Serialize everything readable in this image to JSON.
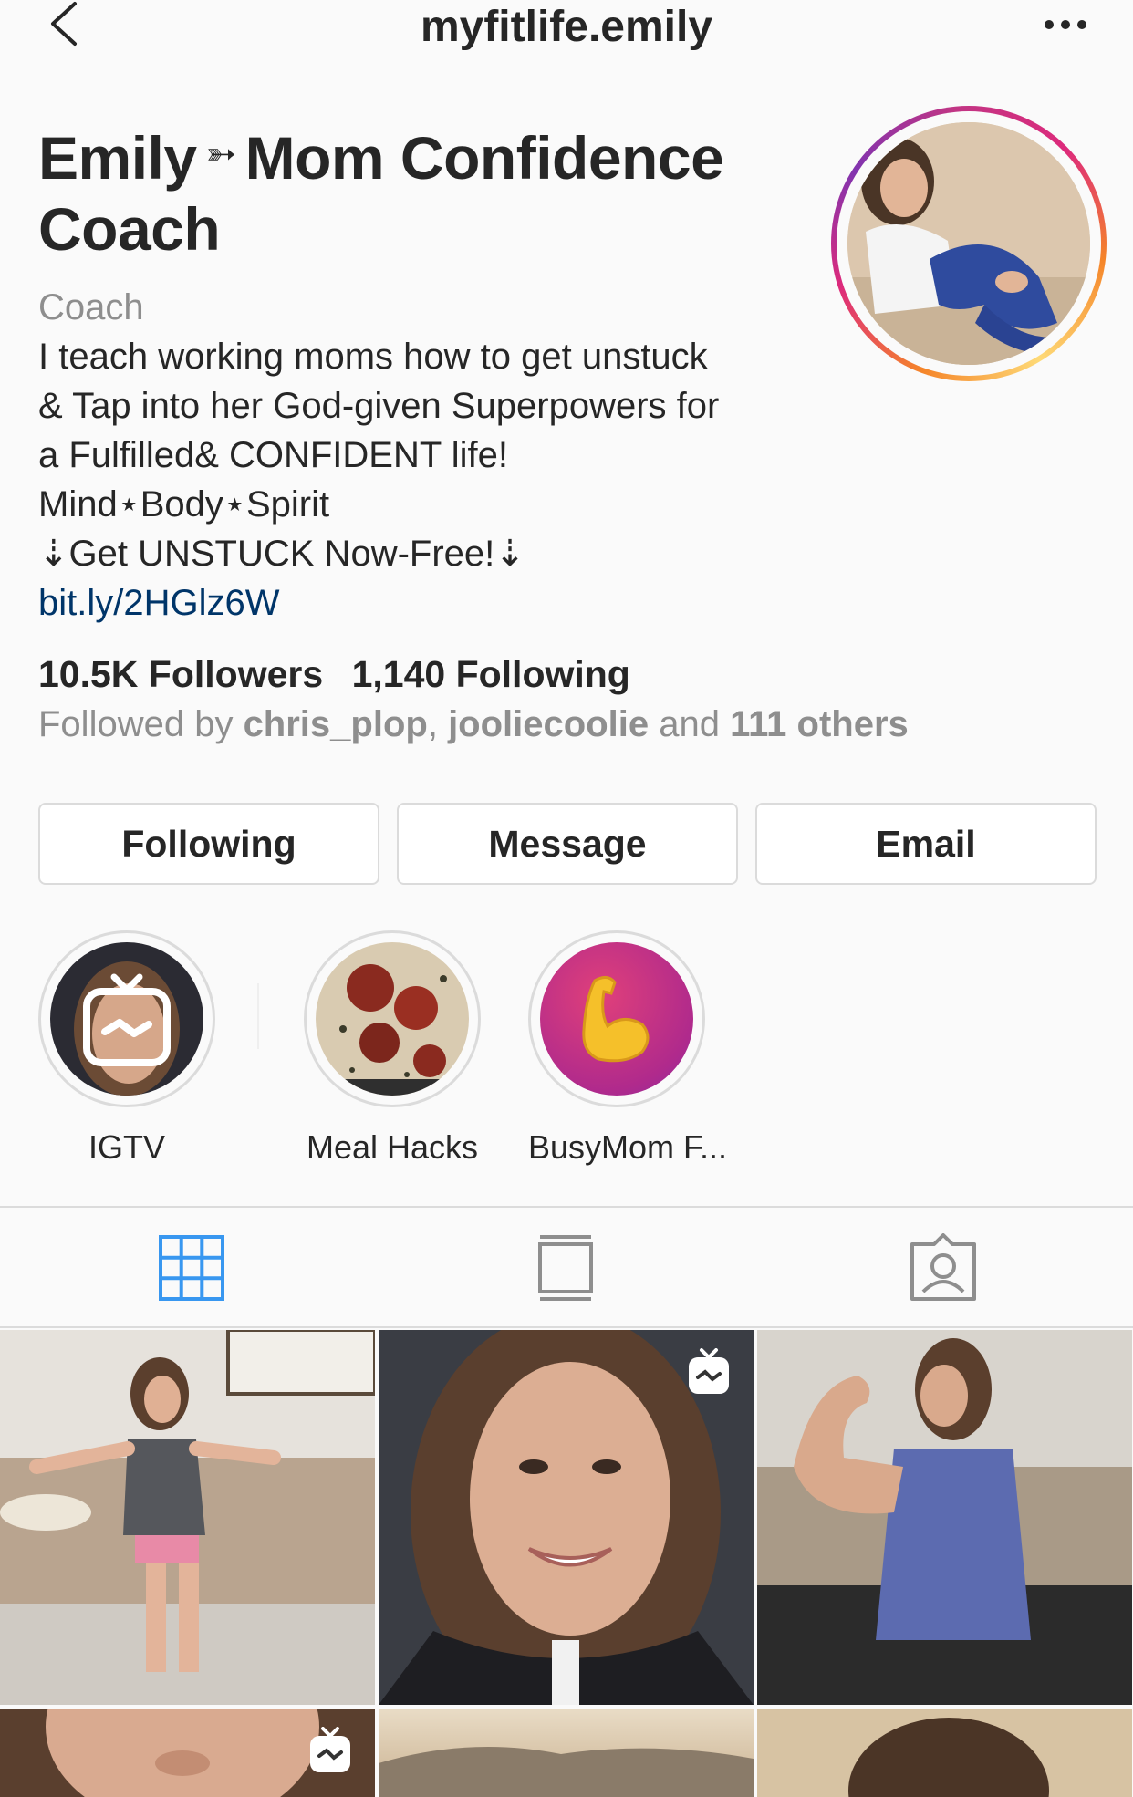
{
  "header": {
    "username": "myfitlife.emily"
  },
  "profile": {
    "name_part1": "Emily",
    "name_arrow": "➳",
    "name_part2": "Mom Confidence",
    "name_line2": "Coach",
    "category": "Coach",
    "bio_lines": [
      "I teach working moms how to get unstuck",
      "& Tap into her God-given Superpowers for",
      "a Fulfilled& CONFIDENT life!",
      "Mind⋆Body⋆Spirit",
      "⇣Get UNSTUCK Now-Free!⇣"
    ],
    "link": "bit.ly/2HGlz6W"
  },
  "stats": {
    "followers": "10.5K Followers",
    "following": "1,140 Following"
  },
  "followed_by": {
    "prefix": "Followed by ",
    "user1": "chris_plop",
    "sep": ", ",
    "user2": "jooliecoolie",
    "and": " and ",
    "others": "111 others"
  },
  "actions": {
    "following": "Following",
    "message": "Message",
    "email": "Email"
  },
  "highlights": [
    {
      "label": "IGTV"
    },
    {
      "label": "Meal Hacks"
    },
    {
      "label": "BusyMom F..."
    }
  ],
  "tabs": {
    "active": "grid",
    "active_color": "#3897f0",
    "inactive_color": "#8e8e8e"
  }
}
